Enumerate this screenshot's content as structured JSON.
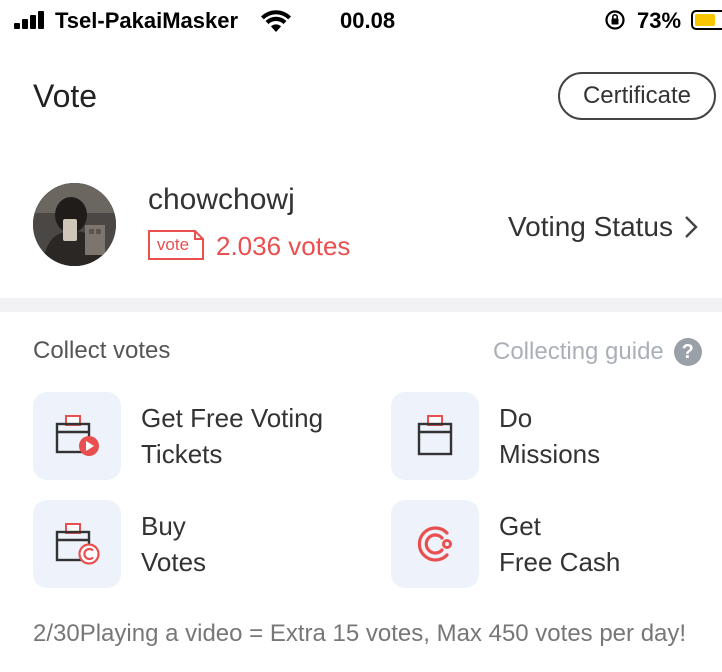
{
  "status_bar": {
    "carrier": "Tsel-PakaiMasker",
    "time": "00.08",
    "battery_percent": "73%",
    "battery_level": 0.73,
    "battery_color": "#f7c600"
  },
  "header": {
    "title": "Vote",
    "certificate_label": "Certificate"
  },
  "profile": {
    "username": "chowchowj",
    "vote_tag": "vote",
    "vote_count": "2.036 votes",
    "voting_status_label": "Voting Status"
  },
  "collect": {
    "title": "Collect votes",
    "guide_label": "Collecting guide",
    "help_glyph": "?",
    "tasks": [
      {
        "label": "Get Free Voting\nTickets",
        "icon": "ticket-play-icon"
      },
      {
        "label": "Do\nMissions",
        "icon": "ticket-icon"
      },
      {
        "label": "Buy\nVotes",
        "icon": "ticket-coin-icon"
      },
      {
        "label": "Get\nFree Cash",
        "icon": "cash-c-icon"
      }
    ],
    "footer_note": "2/30Playing a video = Extra 15 votes, Max 450 votes per day!"
  },
  "colors": {
    "accent_red": "#e94f4f",
    "tile_bg": "#eef3fb",
    "divider": "#f2f2f5"
  }
}
